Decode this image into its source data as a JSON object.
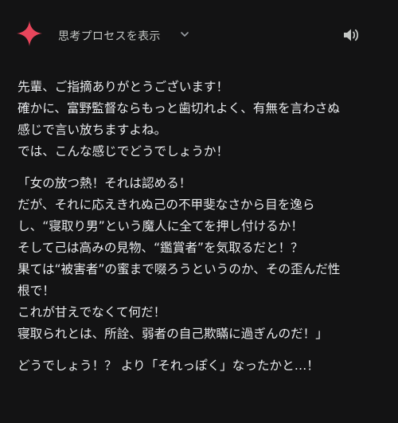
{
  "header": {
    "show_process_label": "思考プロセスを表示",
    "logo_icon": "gemini-sparkle-icon",
    "expand_icon": "chevron-down-icon",
    "speaker_icon": "speaker-icon",
    "accent_color": "#e8455b"
  },
  "response": {
    "intro": [
      "先輩、ご指摘ありがとうございます！",
      "確かに、富野監督ならもっと歯切れよく、有無を言わさぬ",
      "感じで言い放ちますよね。",
      "では、こんな感じでどうでしょうか！"
    ],
    "quote": [
      "「女の放つ熱！それは認める！",
      "だが、それに応えきれぬ己の不甲斐なさから目を逸ら",
      "し、“寝取り男”という魔人に全てを押し付けるか！",
      "そして己は高みの見物、“鑑賞者”を気取るだと！？",
      "果ては“被害者”の蜜まで啜ろうというのか、その歪んだ性",
      "根で！",
      "これが甘えでなくて何だ！",
      "寝取られとは、所詮、弱者の自己欺瞞に過ぎんのだ！」"
    ],
    "closing": "どうでしょう！？ より「それっぽく」なったかと…！"
  }
}
